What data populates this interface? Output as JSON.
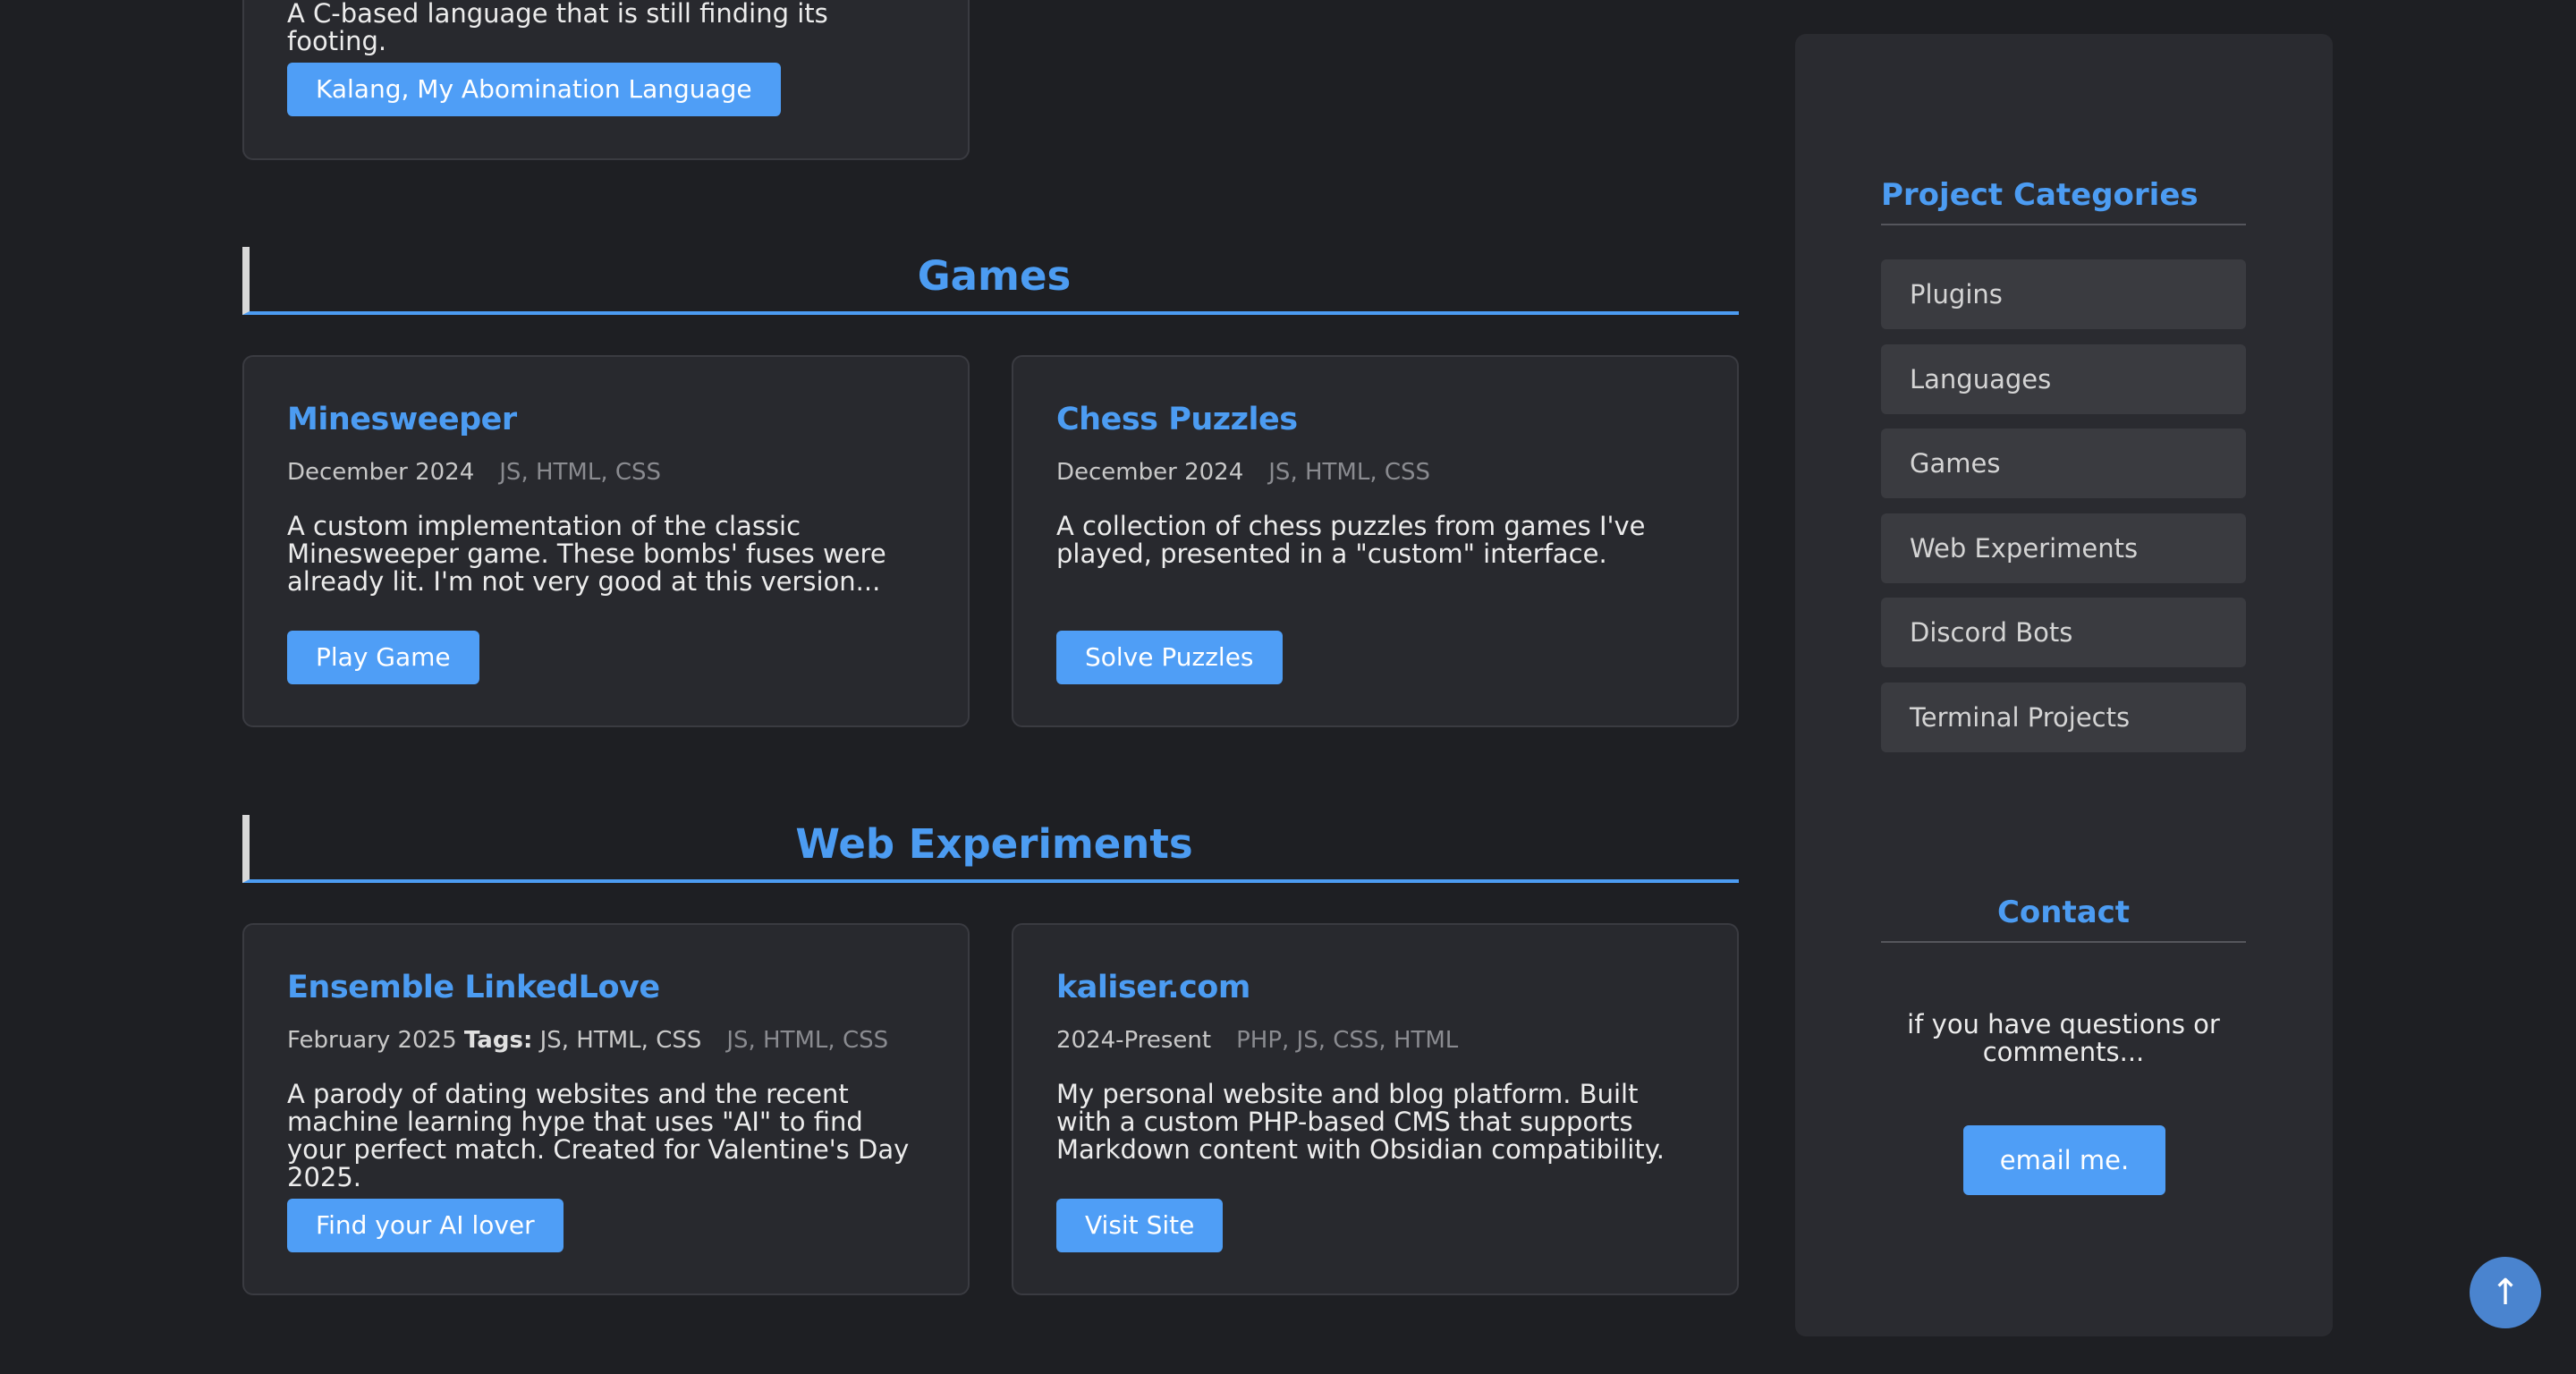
{
  "top_card": {
    "desc": "A C-based language that is still finding its footing.",
    "button": "Kalang, My Abomination Language"
  },
  "sections": [
    {
      "heading": "Games",
      "projects": [
        {
          "title": "Minesweeper",
          "date": "December 2024",
          "tags": "JS, HTML, CSS",
          "desc": "A custom implementation of the classic Minesweeper game. These bombs' fuses were already lit. I'm not very good at this version...",
          "button": "Play Game"
        },
        {
          "title": "Chess Puzzles",
          "date": "December 2024",
          "tags": "JS, HTML, CSS",
          "desc": "A collection of chess puzzles from games I've played, presented in a \"custom\" interface.",
          "button": "Solve Puzzles"
        }
      ]
    },
    {
      "heading": "Web Experiments",
      "projects": [
        {
          "title": "Ensemble LinkedLove",
          "date": "February 2025",
          "inline_tags_label": "Tags:",
          "inline_tags": "JS, HTML, CSS",
          "tags": "JS, HTML, CSS",
          "desc": "A parody of dating websites and the recent machine learning hype that uses \"AI\" to find your perfect match. Created for Valentine's Day 2025.",
          "button": "Find your AI lover"
        },
        {
          "title": "kaliser.com",
          "date": "2024-Present",
          "tags": "PHP, JS, CSS, HTML",
          "desc": "My personal website and blog platform. Built with a custom PHP-based CMS that supports Markdown content with Obsidian compatibility.",
          "button": "Visit Site"
        }
      ]
    }
  ],
  "sidebar": {
    "categories_heading": "Project Categories",
    "categories": [
      "Plugins",
      "Languages",
      "Games",
      "Web Experiments",
      "Discord Bots",
      "Terminal Projects"
    ],
    "contact_heading": "Contact",
    "contact_text": "if you have questions or comments...",
    "email_button": "email me."
  },
  "scroll_top": {
    "icon": "arrow-up-icon",
    "glyph": "↑"
  },
  "colors": {
    "background": "#1e1f23",
    "card": "#28292e",
    "accent": "#4c9cf2",
    "button": "#4f9ef6"
  }
}
